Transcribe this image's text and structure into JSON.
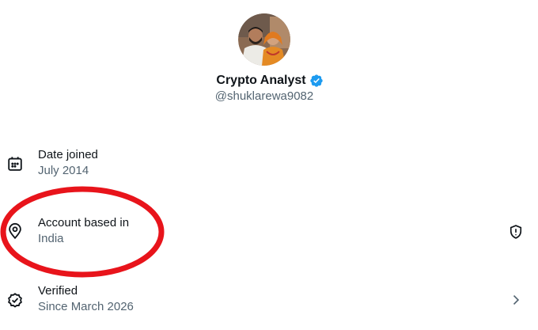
{
  "profile": {
    "display_name": "Crypto Analyst",
    "handle": "@shuklarewa9082",
    "verified": true
  },
  "details": [
    {
      "title": "Date joined",
      "value": "July 2014",
      "icon": "calendar-icon"
    },
    {
      "title": "Account based in",
      "value": "India",
      "icon": "location-pin-icon",
      "trailing_icon": "shield-alert-icon"
    },
    {
      "title": "Verified",
      "value": "Since March 2026",
      "icon": "verified-check-icon",
      "trailing_icon": "chevron-right-icon"
    }
  ],
  "annotation": {
    "shape": "ellipse",
    "color": "#e8141b",
    "target": "Account based in"
  },
  "colors": {
    "primary_text": "#0f1419",
    "secondary_text": "#536471",
    "verified_blue": "#1d9bf0",
    "annotation_red": "#e8141b"
  }
}
